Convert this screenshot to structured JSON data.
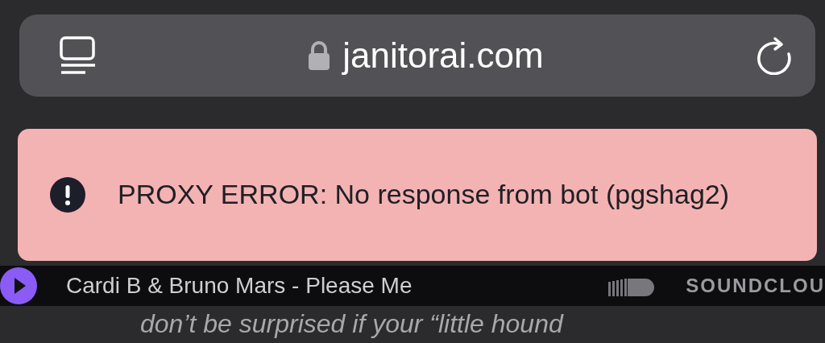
{
  "address_bar": {
    "url": "janitorai.com"
  },
  "toast": {
    "message": "PROXY ERROR: No response from bot (pgshag2)"
  },
  "player": {
    "track": "Cardi B & Bruno Mars - Please Me",
    "brand": "SOUNDCLOU"
  },
  "content": {
    "text": "don’t be surprised if your “little hound"
  }
}
